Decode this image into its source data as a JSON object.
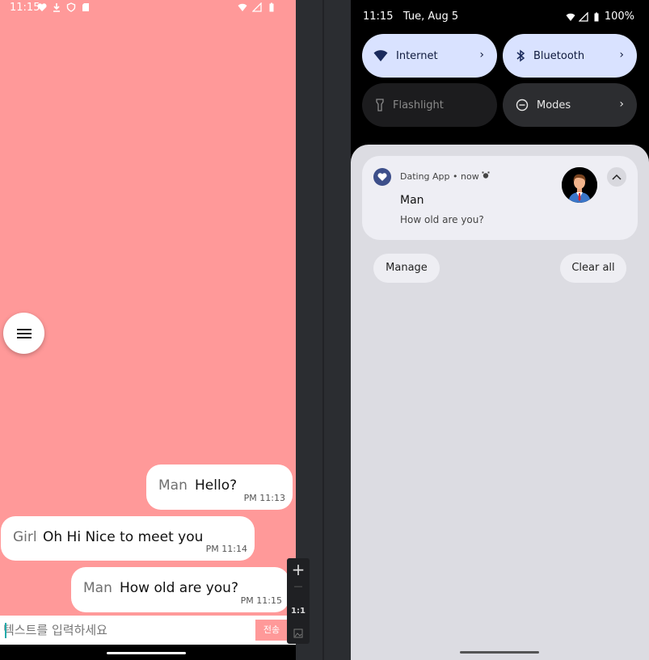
{
  "left_phone": {
    "status_bar": {
      "time": "11:15"
    },
    "messages": [
      {
        "sender": "Man",
        "text": "Hello?",
        "time": "PM 11:13"
      },
      {
        "sender": "Girl",
        "text": "Oh Hi Nice to meet you",
        "time": "PM 11:14"
      },
      {
        "sender": "Man",
        "text": "How old are you?",
        "time": "PM 11:15"
      }
    ],
    "input": {
      "placeholder": "텍스트를 입력하세요",
      "send_label": "전송"
    },
    "colors": {
      "background": "#ff9999",
      "bubble": "#ffffff"
    }
  },
  "zoom_toolbar": {
    "plus": "+",
    "minus": "—",
    "ratio": "1:1"
  },
  "right_phone": {
    "status_bar": {
      "time": "11:15",
      "date": "Tue, Aug 5",
      "battery": "100%"
    },
    "quick_tiles": [
      {
        "label": "Internet",
        "icon": "wifi-icon",
        "active": true
      },
      {
        "label": "Bluetooth",
        "icon": "bluetooth-icon",
        "active": true
      },
      {
        "label": "Flashlight",
        "icon": "flashlight-icon",
        "active": false
      },
      {
        "label": "Modes",
        "icon": "modes-icon",
        "active": false
      }
    ],
    "notification": {
      "app": "Dating App",
      "separator": "•",
      "when": "now",
      "title": "Man",
      "body": "How old are you?"
    },
    "actions": {
      "manage": "Manage",
      "clear_all": "Clear all"
    },
    "colors": {
      "tile_active": "#d9e2ff",
      "shade": "#dcdce2",
      "accent": "#3d4f8a"
    }
  }
}
